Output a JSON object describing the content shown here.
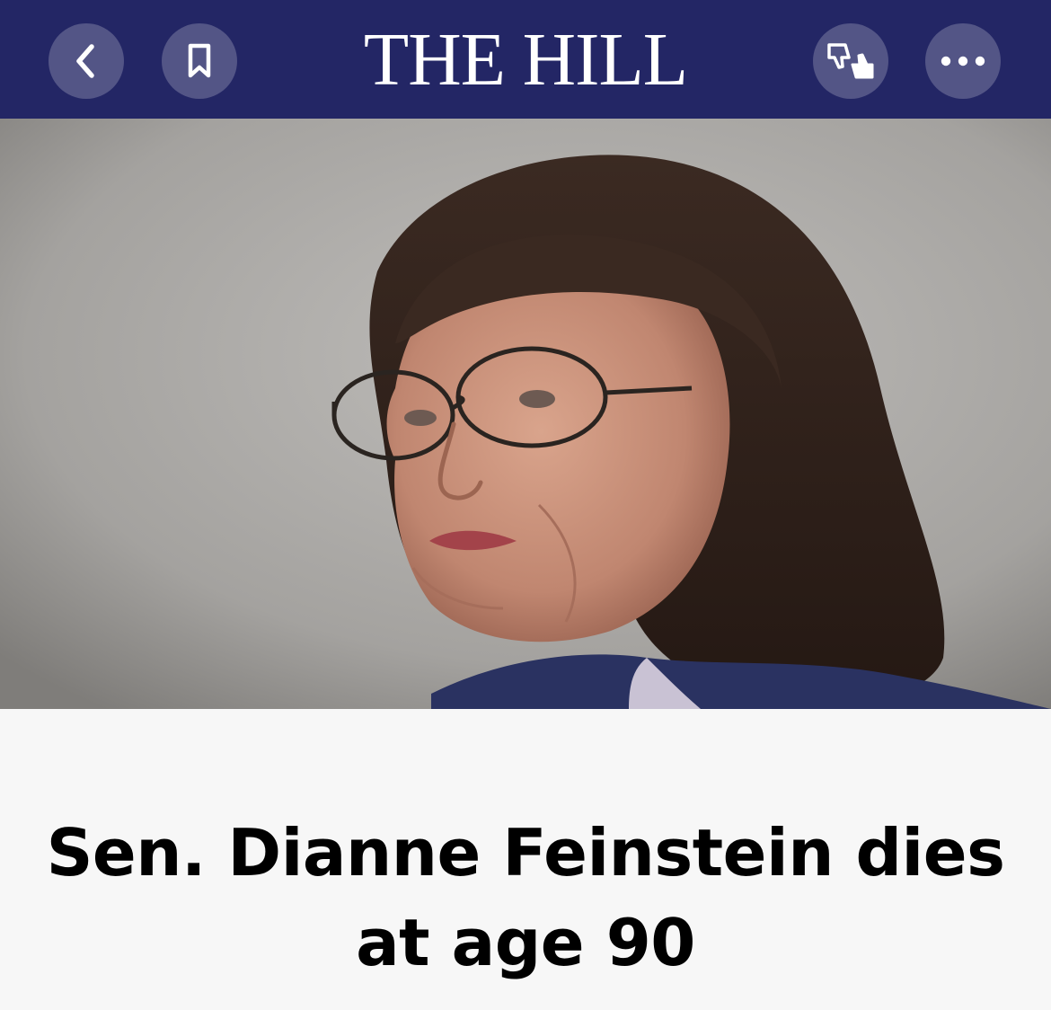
{
  "colors": {
    "brand": "#232665",
    "headline_text": "#000000",
    "background": "#f7f7f7"
  },
  "header": {
    "logo_text": "THE HILL",
    "back_icon": "chevron-left-icon",
    "bookmark_icon": "bookmark-icon",
    "reactions_icon": "thumbs-up-down-icon",
    "more_icon": "more-horizontal-icon"
  },
  "article": {
    "headline": "Sen. Dianne Feinstein dies at age 90"
  }
}
